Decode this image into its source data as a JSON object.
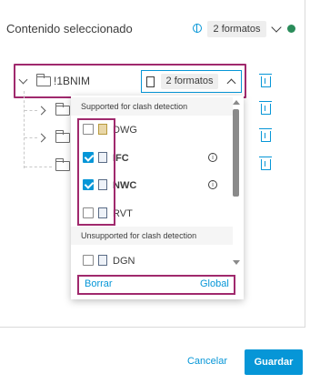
{
  "panel": {
    "title": "Contenido seleccionado",
    "formats_badge": "2 formatos"
  },
  "tree": {
    "root_label": "!1BNIM",
    "root_formats_badge": "2 formatos"
  },
  "dropdown": {
    "supported_header": "Supported for clash detection",
    "unsupported_header": "Unsupported for clash detection",
    "supported_formats": [
      {
        "label": "DWG",
        "checked": false,
        "info": false
      },
      {
        "label": "IFC",
        "checked": true,
        "info": true
      },
      {
        "label": "NWC",
        "checked": true,
        "info": true
      },
      {
        "label": "RVT",
        "checked": false,
        "info": false
      }
    ],
    "unsupported_formats": [
      {
        "label": "DGN",
        "checked": false
      }
    ],
    "clear_label": "Borrar",
    "global_label": "Global"
  },
  "footer": {
    "cancel_label": "Cancelar",
    "save_label": "Guardar"
  },
  "colors": {
    "accent": "#0696d7",
    "highlight": "#a0296d"
  }
}
